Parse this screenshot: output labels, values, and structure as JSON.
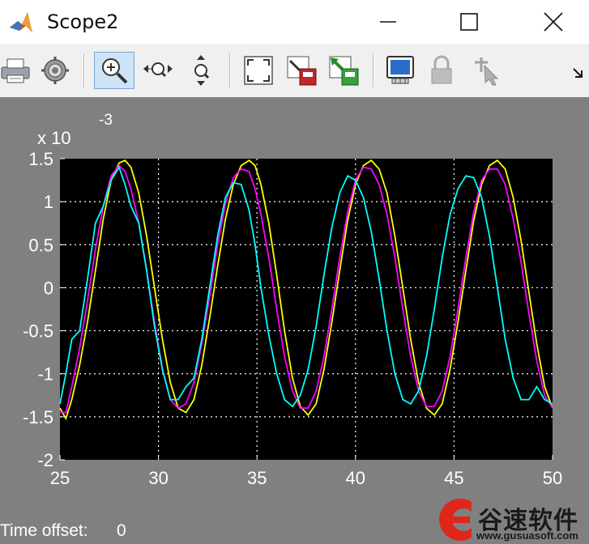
{
  "window": {
    "title": "Scope2",
    "controls": [
      "minimize",
      "maximize",
      "close"
    ]
  },
  "toolbar": {
    "buttons": [
      {
        "name": "print",
        "icon": "printer-icon"
      },
      {
        "name": "parameters",
        "icon": "gear-icon"
      },
      {
        "name": "zoom-in",
        "icon": "zoom-in-icon",
        "active": true
      },
      {
        "name": "zoom-x",
        "icon": "zoom-x-icon"
      },
      {
        "name": "zoom-y",
        "icon": "zoom-y-icon"
      },
      {
        "name": "autoscale",
        "icon": "autoscale-icon"
      },
      {
        "name": "save-axes",
        "icon": "save-axes-icon"
      },
      {
        "name": "restore-axes",
        "icon": "restore-axes-icon"
      },
      {
        "name": "floating-scope",
        "icon": "floating-scope-icon"
      },
      {
        "name": "lock-axes",
        "icon": "lock-icon"
      },
      {
        "name": "signal-selection",
        "icon": "signal-selection-icon"
      }
    ]
  },
  "status": {
    "time_offset_label": "Time offset:",
    "time_offset_value": "0"
  },
  "watermark": {
    "text": "谷速软件",
    "url": "www.gusuasoft.com"
  },
  "colors": {
    "plot_bg": "#000000",
    "figure_bg": "#808080",
    "series_yellow": "#ffff00",
    "series_magenta": "#ff00ff",
    "series_cyan": "#00ffff"
  },
  "chart_data": {
    "type": "line",
    "title": "",
    "xlabel": "",
    "ylabel": "",
    "y_exponent_label": "x 10",
    "y_exponent_power": "-3",
    "xlim": [
      25,
      50
    ],
    "ylim": [
      -2,
      1.5
    ],
    "xticks": [
      "25",
      "30",
      "35",
      "40",
      "45",
      "50"
    ],
    "yticks": [
      "1.5",
      "1",
      "0.5",
      "0",
      "-0.5",
      "-1",
      "-1.5",
      "-2"
    ],
    "grid": true,
    "series": [
      {
        "color": "#ffff00",
        "x": [
          25,
          25.3,
          25.6,
          26.0,
          26.4,
          26.8,
          27.2,
          27.6,
          28.0,
          28.3,
          28.6,
          29.0,
          29.4,
          29.8,
          30.2,
          30.6,
          31.0,
          31.4,
          31.8,
          32.2,
          32.6,
          33.0,
          33.4,
          33.8,
          34.2,
          34.6,
          34.9,
          35.2,
          35.6,
          36.0,
          36.4,
          36.8,
          37.2,
          37.6,
          38.0,
          38.4,
          38.8,
          39.2,
          39.6,
          40.0,
          40.4,
          40.8,
          41.2,
          41.6,
          42.0,
          42.4,
          42.8,
          43.2,
          43.6,
          44.0,
          44.4,
          44.8,
          45.2,
          45.6,
          46.0,
          46.4,
          46.8,
          47.2,
          47.6,
          48.0,
          48.4,
          48.8,
          49.2,
          49.6,
          50
        ],
        "y": [
          -1.4,
          -1.52,
          -1.3,
          -0.9,
          -0.4,
          0.2,
          0.8,
          1.25,
          1.45,
          1.48,
          1.4,
          1.1,
          0.6,
          0.0,
          -0.6,
          -1.1,
          -1.4,
          -1.45,
          -1.3,
          -0.9,
          -0.35,
          0.25,
          0.8,
          1.2,
          1.42,
          1.48,
          1.42,
          1.2,
          0.75,
          0.15,
          -0.5,
          -1.05,
          -1.38,
          -1.48,
          -1.35,
          -0.95,
          -0.4,
          0.2,
          0.78,
          1.2,
          1.42,
          1.48,
          1.38,
          1.1,
          0.6,
          0.0,
          -0.6,
          -1.1,
          -1.4,
          -1.48,
          -1.35,
          -0.95,
          -0.4,
          0.2,
          0.78,
          1.2,
          1.42,
          1.48,
          1.38,
          1.05,
          0.55,
          -0.05,
          -0.65,
          -1.15,
          -1.4
        ]
      },
      {
        "color": "#ff00ff",
        "x": [
          25,
          25.3,
          25.6,
          26.0,
          26.4,
          26.8,
          27.2,
          27.6,
          28.0,
          28.3,
          28.6,
          29.0,
          29.4,
          29.8,
          30.2,
          30.6,
          31.0,
          31.4,
          31.8,
          32.2,
          32.6,
          33.0,
          33.4,
          33.8,
          34.2,
          34.6,
          34.9,
          35.2,
          35.6,
          36.0,
          36.4,
          36.8,
          37.2,
          37.6,
          38.0,
          38.4,
          38.8,
          39.2,
          39.6,
          40.0,
          40.4,
          40.8,
          41.2,
          41.6,
          42.0,
          42.4,
          42.8,
          43.2,
          43.6,
          44.0,
          44.4,
          44.8,
          45.2,
          45.6,
          46.0,
          46.4,
          46.8,
          47.2,
          47.6,
          48.0,
          48.4,
          48.8,
          49.2,
          49.6,
          50
        ],
        "y": [
          -1.45,
          -1.45,
          -1.15,
          -0.7,
          -0.15,
          0.45,
          0.95,
          1.3,
          1.42,
          1.35,
          1.15,
          0.75,
          0.2,
          -0.4,
          -0.95,
          -1.3,
          -1.4,
          -1.35,
          -1.1,
          -0.65,
          -0.1,
          0.5,
          0.98,
          1.28,
          1.38,
          1.35,
          1.15,
          0.85,
          0.35,
          -0.25,
          -0.8,
          -1.2,
          -1.4,
          -1.4,
          -1.2,
          -0.8,
          -0.25,
          0.35,
          0.88,
          1.25,
          1.4,
          1.38,
          1.2,
          0.85,
          0.35,
          -0.25,
          -0.8,
          -1.2,
          -1.38,
          -1.38,
          -1.2,
          -0.8,
          -0.25,
          0.35,
          0.88,
          1.25,
          1.38,
          1.38,
          1.2,
          0.8,
          0.3,
          -0.3,
          -0.85,
          -1.25,
          -1.4
        ]
      },
      {
        "color": "#00ffff",
        "x": [
          25,
          25.3,
          25.6,
          26.0,
          26.4,
          26.8,
          27.2,
          27.6,
          28.0,
          28.3,
          28.6,
          29.0,
          29.4,
          29.8,
          30.2,
          30.6,
          31.0,
          31.4,
          31.8,
          32.2,
          32.6,
          33.0,
          33.4,
          33.8,
          34.2,
          34.6,
          34.9,
          35.2,
          35.6,
          36.0,
          36.4,
          36.8,
          37.2,
          37.6,
          38.0,
          38.4,
          38.8,
          39.2,
          39.6,
          40.0,
          40.4,
          40.8,
          41.2,
          41.6,
          42.0,
          42.4,
          42.8,
          43.2,
          43.6,
          44.0,
          44.4,
          44.8,
          45.2,
          45.6,
          46.0,
          46.4,
          46.8,
          47.2,
          47.6,
          48.0,
          48.4,
          48.8,
          49.2,
          49.6,
          50
        ],
        "y": [
          -1.35,
          -1.0,
          -0.6,
          -0.5,
          0.1,
          0.75,
          0.95,
          1.25,
          1.4,
          1.2,
          0.95,
          0.75,
          0.2,
          -0.45,
          -0.95,
          -1.3,
          -1.3,
          -1.15,
          -1.05,
          -0.6,
          0.0,
          0.6,
          1.05,
          1.22,
          1.2,
          0.9,
          0.5,
          0.0,
          -0.55,
          -1.0,
          -1.3,
          -1.38,
          -1.25,
          -0.95,
          -0.45,
          0.15,
          0.7,
          1.1,
          1.3,
          1.25,
          1.05,
          0.65,
          0.1,
          -0.5,
          -1.0,
          -1.3,
          -1.35,
          -1.2,
          -0.8,
          -0.25,
          0.35,
          0.85,
          1.15,
          1.3,
          1.28,
          1.05,
          0.6,
          0.0,
          -0.6,
          -1.05,
          -1.3,
          -1.3,
          -1.15,
          -1.3,
          -1.35
        ]
      }
    ]
  }
}
